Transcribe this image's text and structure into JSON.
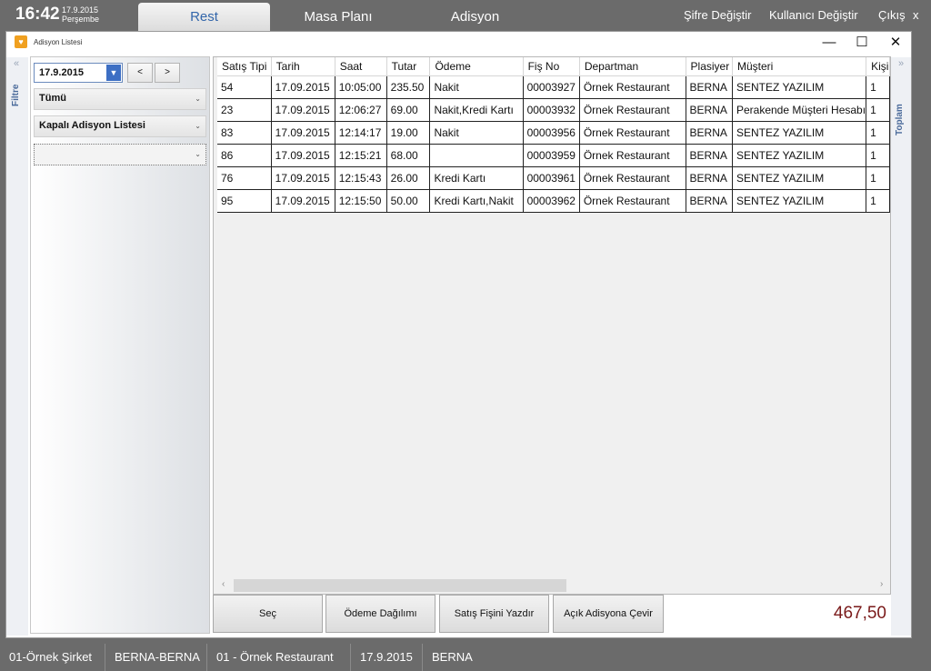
{
  "topbar": {
    "time": "16:42",
    "date": "17.9.2015",
    "day": "Perşembe",
    "tabs": [
      "Rest",
      "Masa Planı",
      "Adisyon"
    ],
    "links": [
      "Şifre Değiştir",
      "Kullanıcı Değiştir",
      "Çıkış"
    ],
    "close": "x"
  },
  "window": {
    "title": "Adisyon Listesi",
    "minimize": "—",
    "maximize": "☐",
    "close": "✕"
  },
  "side": {
    "left_label": "Filtre",
    "right_label": "Toplam",
    "left_chevron": "«",
    "right_chevron": "»"
  },
  "filter": {
    "date": "17.9.2015",
    "prev": "<",
    "next": ">",
    "combo1": "Tümü",
    "combo2": "Kapalı Adisyon Listesi",
    "combo3": ""
  },
  "grid": {
    "columns": [
      "Satış Tipi",
      "Tarih",
      "Saat",
      "Tutar",
      "Ödeme",
      "Fiş No",
      "Departman",
      "Plasiyer",
      "Müşteri",
      "Kişi"
    ],
    "rows": [
      [
        "54",
        "17.09.2015",
        "10:05:00",
        "235.50",
        "Nakit",
        "00003927",
        "Örnek Restaurant",
        "BERNA",
        "SENTEZ YAZILIM",
        "1"
      ],
      [
        "23",
        "17.09.2015",
        "12:06:27",
        "69.00",
        "Nakit,Kredi Kartı",
        "00003932",
        "Örnek Restaurant",
        "BERNA",
        "Perakende Müşteri Hesabı",
        "1"
      ],
      [
        "83",
        "17.09.2015",
        "12:14:17",
        "19.00",
        "Nakit",
        "00003956",
        "Örnek Restaurant",
        "BERNA",
        "SENTEZ YAZILIM",
        "1"
      ],
      [
        "86",
        "17.09.2015",
        "12:15:21",
        "68.00",
        "",
        "00003959",
        "Örnek Restaurant",
        "BERNA",
        "SENTEZ YAZILIM",
        "1"
      ],
      [
        "76",
        "17.09.2015",
        "12:15:43",
        "26.00",
        "Kredi Kartı",
        "00003961",
        "Örnek Restaurant",
        "BERNA",
        "SENTEZ YAZILIM",
        "1"
      ],
      [
        "95",
        "17.09.2015",
        "12:15:50",
        "50.00",
        "Kredi Kartı,Nakit",
        "00003962",
        "Örnek Restaurant",
        "BERNA",
        "SENTEZ YAZILIM",
        "1"
      ]
    ]
  },
  "actions": {
    "select": "Seç",
    "payment_split": "Ödeme Dağılımı",
    "print_receipt": "Satış Fişini Yazdır",
    "open_check": "Açık Adisyona Çevir",
    "total": "467,50"
  },
  "status": [
    "01-Örnek Şirket",
    "BERNA-BERNA",
    "01 - Örnek Restaurant",
    "17.9.2015",
    "BERNA"
  ],
  "colors": {
    "topbar": "#6b6b6b",
    "accent": "#3d6fc4",
    "total": "#7a1a1a"
  }
}
